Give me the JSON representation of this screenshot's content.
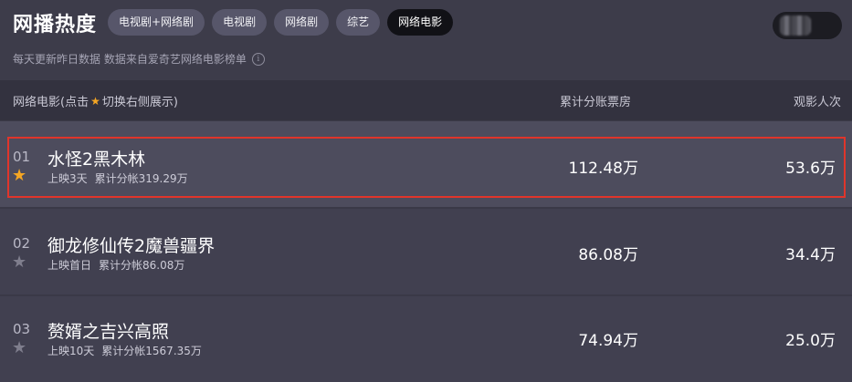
{
  "header": {
    "title": "网播热度",
    "tabs": [
      {
        "label": "电视剧+网络剧",
        "active": false
      },
      {
        "label": "电视剧",
        "active": false
      },
      {
        "label": "网络剧",
        "active": false
      },
      {
        "label": "综艺",
        "active": false
      },
      {
        "label": "网络电影",
        "active": true
      }
    ],
    "subtitle": "每天更新昨日数据 数据来自爱奇艺网络电影榜单",
    "info_icon": "info-icon"
  },
  "table": {
    "col_name_prefix": "网络电影(点击",
    "col_name_suffix": "切换右侧展示)",
    "col_box": "累计分账票房",
    "col_view": "观影人次"
  },
  "rows": [
    {
      "rank": "01",
      "title": "水怪2黑木林",
      "release": "上映3天",
      "total": "累计分帐319.29万",
      "box": "112.48万",
      "view": "53.6万",
      "starred": true
    },
    {
      "rank": "02",
      "title": "御龙修仙传2魔兽疆界",
      "release": "上映首日",
      "total": "累计分帐86.08万",
      "box": "86.08万",
      "view": "34.4万",
      "starred": false
    },
    {
      "rank": "03",
      "title": "赘婿之吉兴高照",
      "release": "上映10天",
      "total": "累计分帐1567.35万",
      "box": "74.94万",
      "view": "25.0万",
      "starred": false
    }
  ],
  "colors": {
    "accent_star": "#f5a623",
    "highlight": "#e0352b",
    "active_tab": "#111116"
  }
}
